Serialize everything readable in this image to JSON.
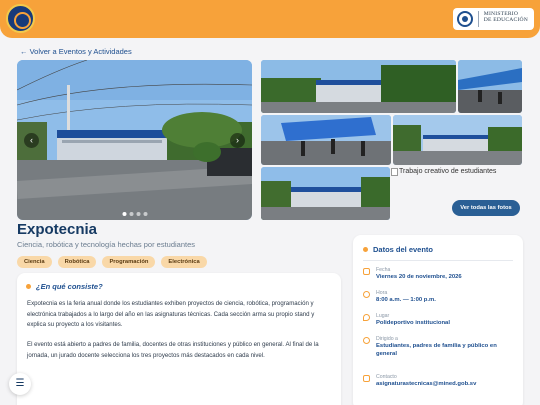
{
  "header": {
    "ministry_line1": "MINISTERIO",
    "ministry_line2": "DE EDUCACIÓN"
  },
  "nav": {
    "back_label": "← Volver a Eventos y Actividades"
  },
  "carousel": {
    "prev_icon": "‹",
    "next_icon": "›",
    "slide_count": 6,
    "active_slide": 1
  },
  "gallery": {
    "missing_image_alt": "Trabajo creativo de estudiantes",
    "view_all_label": "Ver todas las fotos"
  },
  "event": {
    "title": "Expotecnia",
    "subtitle": "Ciencia, robótica y tecnología hechas por estudiantes",
    "tags": [
      "Ciencia",
      "Robótica",
      "Programación",
      "Electrónica"
    ]
  },
  "about": {
    "heading": "¿En qué consiste?",
    "paragraph1": "Expotecnia es la feria anual donde los estudiantes exhiben proyectos de ciencia, robótica, programación y electrónica trabajados a lo largo del año en las asignaturas técnicas. Cada sección arma su propio stand y explica su proyecto a los visitantes.",
    "paragraph2": "El evento está abierto a padres de familia, docentes de otras instituciones y público en general. Al final de la jornada, un jurado docente selecciona los tres proyectos más destacados en cada nivel."
  },
  "details": {
    "heading": "Datos del evento",
    "date_label": "Fecha",
    "date_value": "Viernes 20 de noviembre, 2026",
    "time_label": "Hora",
    "time_value": "8:00 a.m. — 1:00 p.m.",
    "place_label": "Lugar",
    "place_value": "Polideportivo institucional",
    "audience_label": "Dirigido a",
    "audience_value": "Estudiantes, padres de familia y público en general",
    "contact_label": "Contacto",
    "contact_value": "asignaturastecnicas@mined.gob.sv"
  },
  "fab": {
    "icon": "☰"
  },
  "colors": {
    "brand_orange": "#f7a23a",
    "brand_navy": "#1e4f8f",
    "tag_bg": "#f9d8a8"
  }
}
